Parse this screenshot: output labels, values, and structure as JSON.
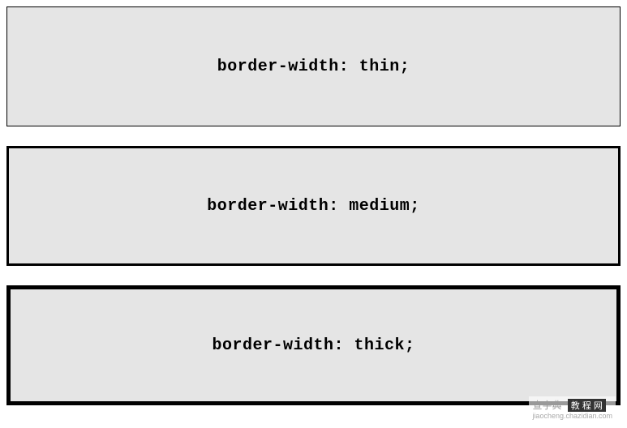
{
  "boxes": [
    {
      "label": "border-width: thin;"
    },
    {
      "label": "border-width: medium;"
    },
    {
      "label": "border-width: thick;"
    }
  ],
  "watermark": {
    "left": "查字典",
    "middle": "教 程 网",
    "url": "jiaocheng.chazidian.com"
  }
}
